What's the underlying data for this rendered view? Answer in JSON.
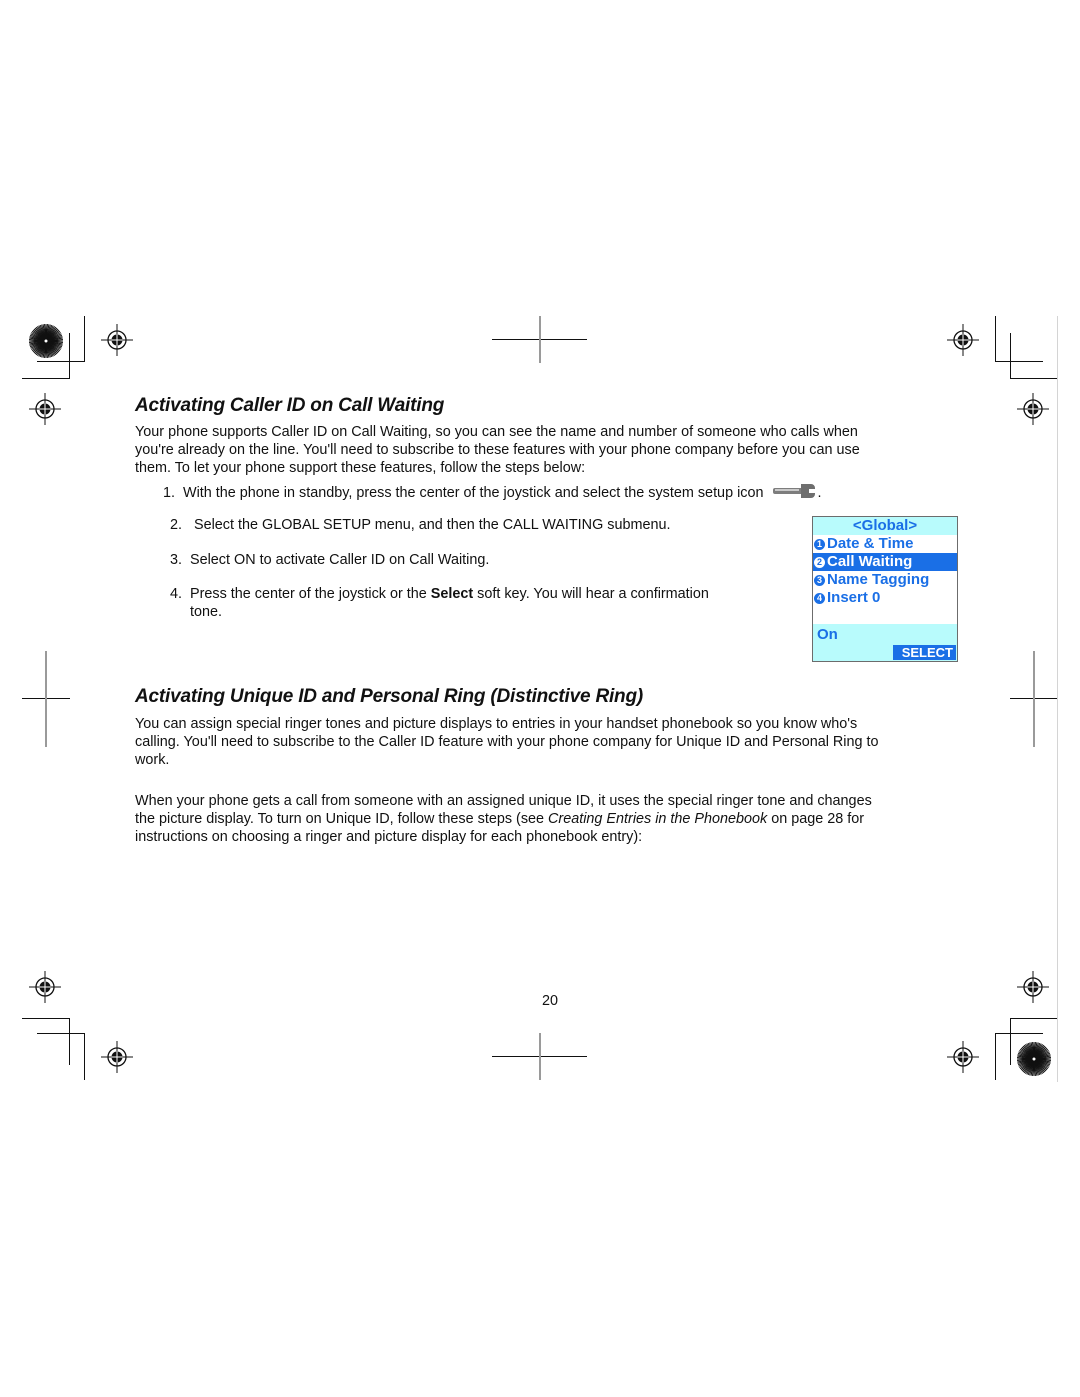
{
  "section1": {
    "heading": "Activating Caller ID on Call Waiting",
    "intro_lines": [
      "Your phone supports Caller ID on Call Waiting, so you can see the name and number of someone who calls when",
      "you're already on the line. You'll need to subscribe to these features with your phone company before you can use",
      "them. To let your phone support these features, follow the steps below:"
    ],
    "steps": [
      {
        "num": "1.",
        "text": "With the phone in standby, press the center of the joystick and select the system setup icon",
        "suffix": ".",
        "icon": "wrench-icon"
      },
      {
        "num": "2.",
        "text": " Select the GLOBAL SETUP menu, and then the CALL WAITING submenu."
      },
      {
        "num": "3.",
        "text": "Select ON to activate Caller ID on Call Waiting."
      },
      {
        "num": "4.",
        "text_before": "Press the center of the joystick or the ",
        "bold": "Select",
        "text_after": " soft key. You will hear a confirmation",
        "continuation": "tone."
      }
    ]
  },
  "phone_screen": {
    "title": "<Global>",
    "items": [
      {
        "badge": "1",
        "label": "Date & Time",
        "selected": false
      },
      {
        "badge": "2",
        "label": "Call Waiting",
        "selected": true
      },
      {
        "badge": "3",
        "label": "Name Tagging",
        "selected": false
      },
      {
        "badge": "4",
        "label": "Insert 0",
        "selected": false
      }
    ],
    "current_value": "On",
    "soft_key": "SELECT",
    "colors": {
      "accent": "#1a6fe6",
      "panel": "#b8fbfc"
    }
  },
  "section2": {
    "heading": "Activating Unique ID and Personal Ring (Distinctive Ring)",
    "para1_lines": [
      "You can assign special ringer tones and picture displays to entries in your handset phonebook so you know who's",
      "calling. You'll need to subscribe to the Caller ID feature with your phone company for Unique ID and Personal Ring to",
      "work."
    ],
    "para2": {
      "line1": "When your phone gets a call from someone with an assigned unique ID, it uses the special ringer tone and changes",
      "line2_before": "the picture display. To turn on Unique ID, follow these steps (see ",
      "line2_italic": "Creating Entries in the Phonebook",
      "line2_after": " on page 28 for",
      "line3": "instructions on choosing a ringer and picture display for each phonebook entry):"
    }
  },
  "footer": {
    "page_number": "20"
  }
}
